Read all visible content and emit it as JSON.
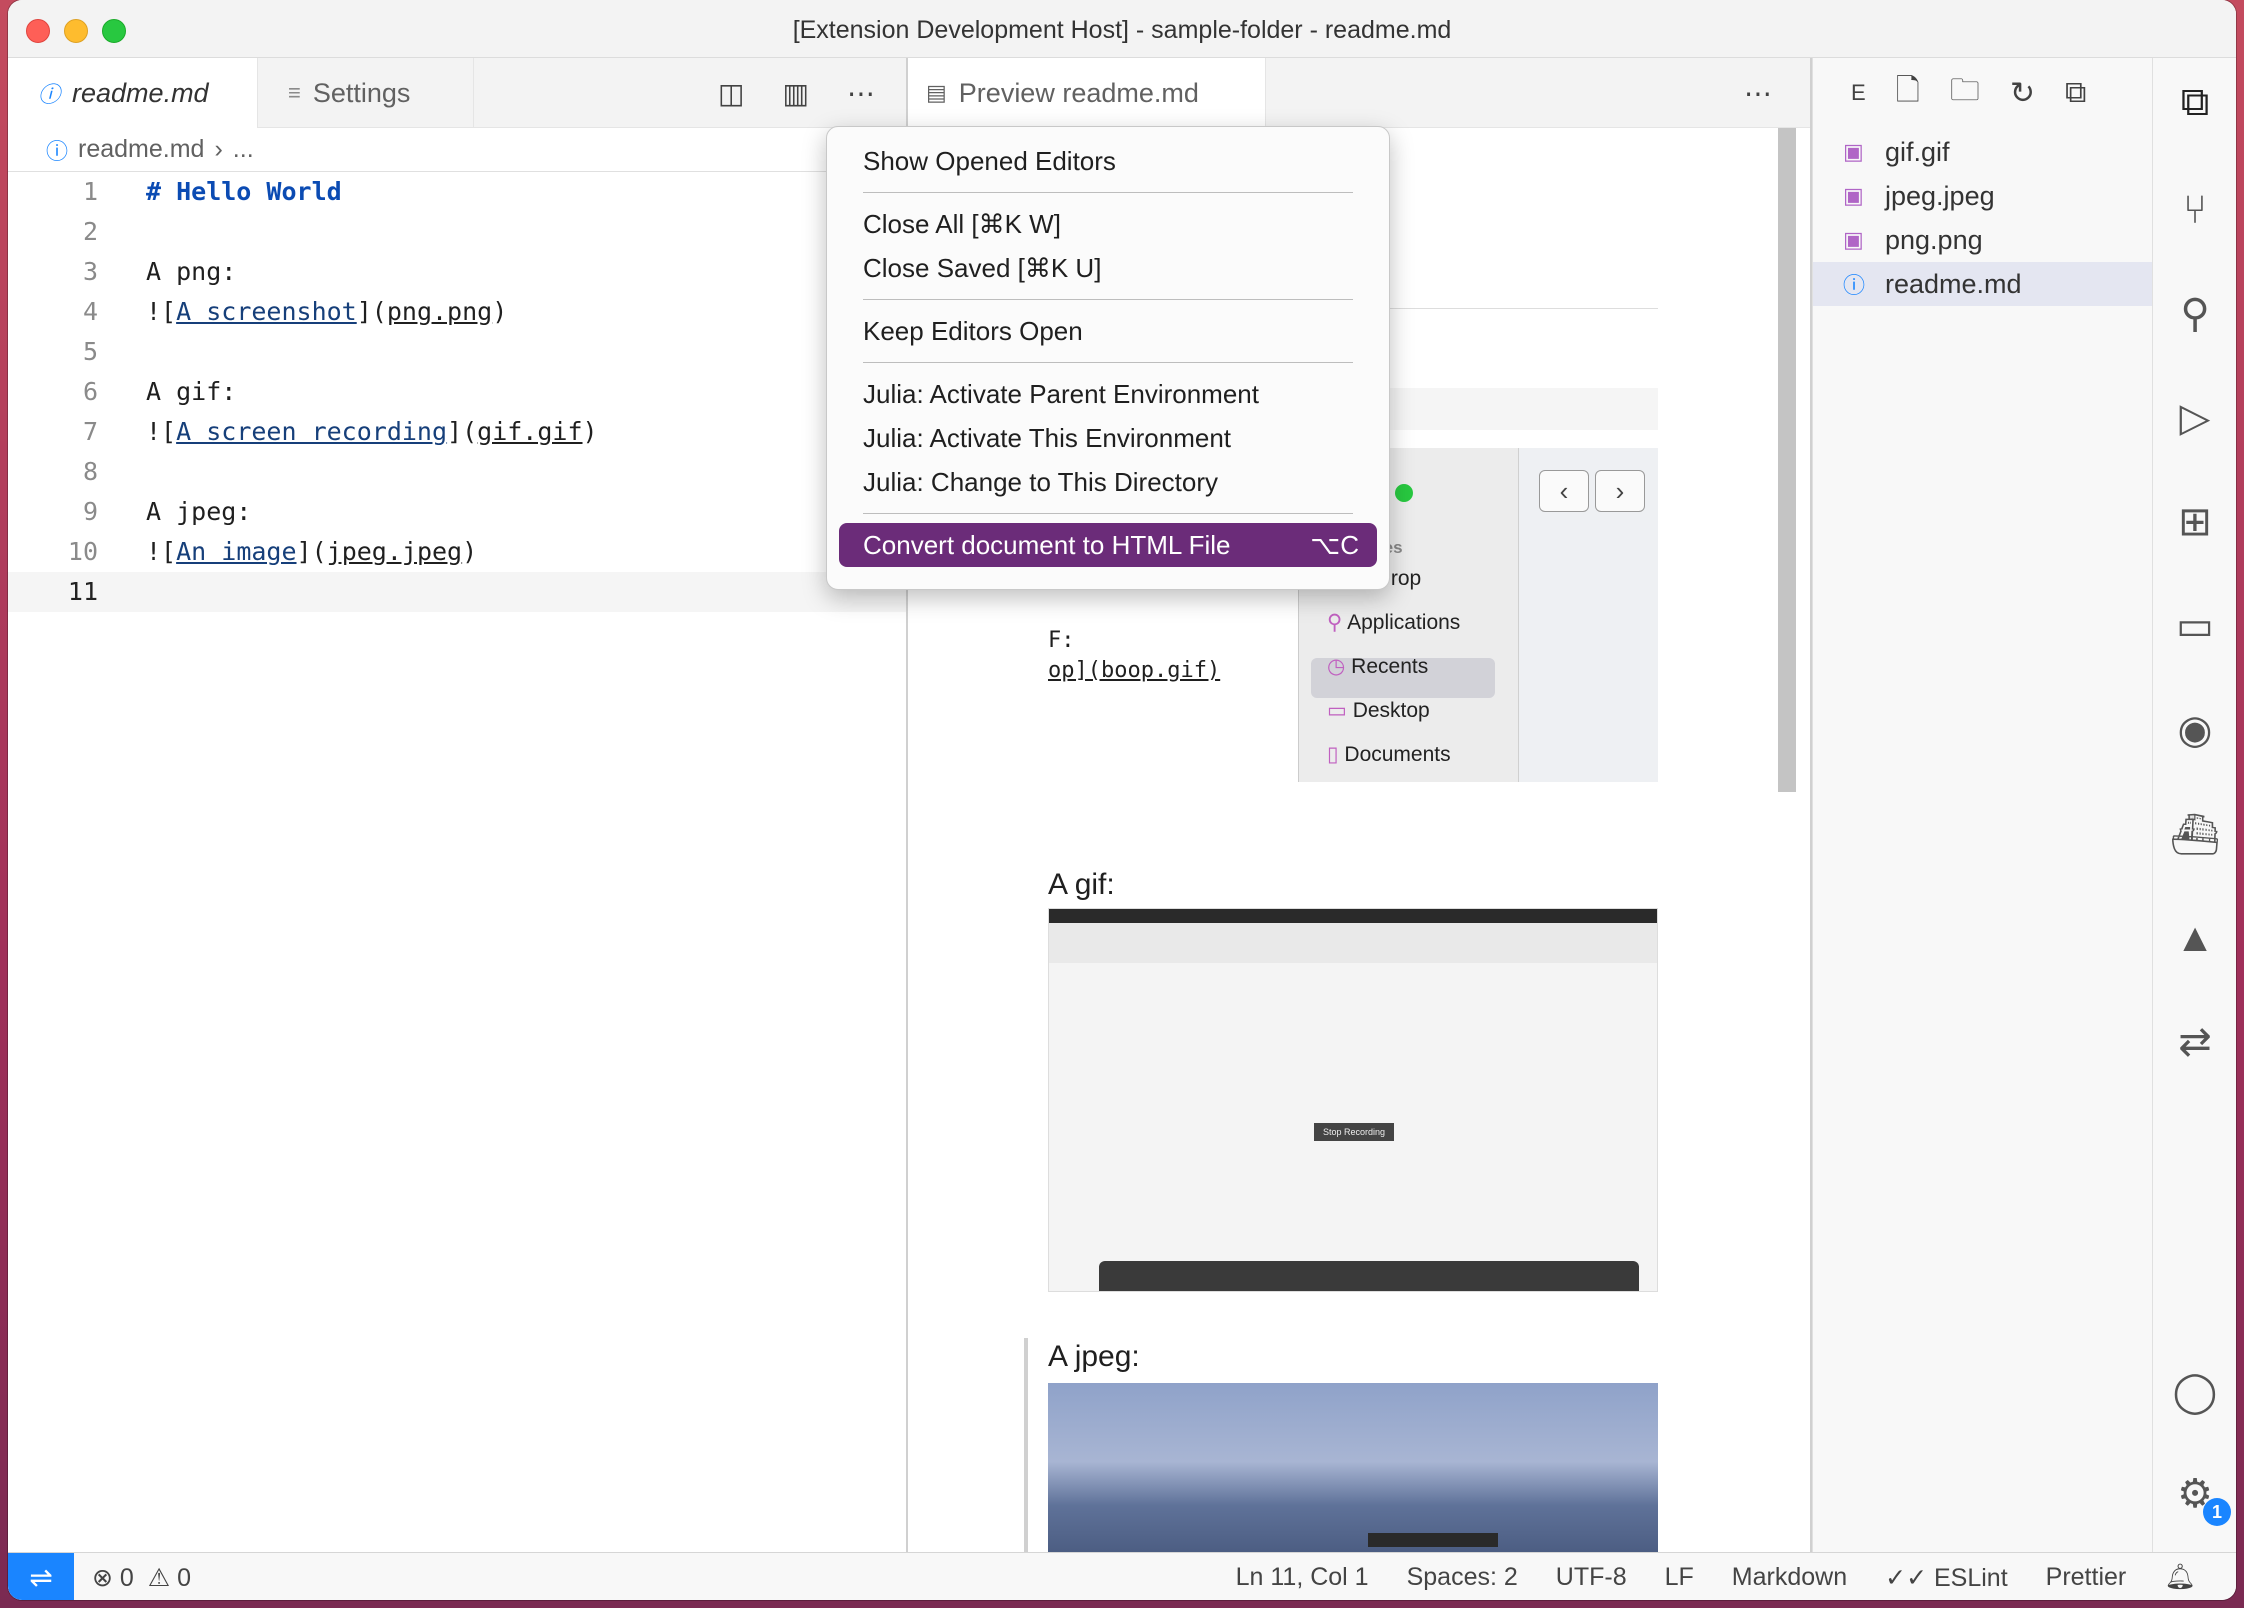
{
  "window": {
    "title": "[Extension Development Host] - sample-folder - readme.md"
  },
  "editor": {
    "tabs": [
      {
        "label": "readme.md",
        "active": true
      },
      {
        "label": "Settings",
        "active": false
      }
    ],
    "breadcrumb": {
      "file": "readme.md",
      "more": "..."
    },
    "lines": [
      {
        "num": "1",
        "text": "# Hello World"
      },
      {
        "num": "2",
        "text": ""
      },
      {
        "num": "3",
        "text": "A png:"
      },
      {
        "num": "4",
        "prefix": "![",
        "link": "A screenshot",
        "mid": "](",
        "target": "png.png",
        "suffix": ")"
      },
      {
        "num": "5",
        "text": ""
      },
      {
        "num": "6",
        "text": "A gif:"
      },
      {
        "num": "7",
        "prefix": "![",
        "link": "A screen recording",
        "mid": "](",
        "target": "gif.gif",
        "suffix": ")"
      },
      {
        "num": "8",
        "text": ""
      },
      {
        "num": "9",
        "text": "A jpeg:"
      },
      {
        "num": "10",
        "prefix": "![",
        "link": "An image",
        "mid": "](",
        "target": "jpeg.jpeg",
        "suffix": ")"
      },
      {
        "num": "11",
        "text": ""
      }
    ]
  },
  "preview": {
    "tab_label": "Preview readme.md",
    "fragment_code_1": "F:",
    "fragment_code_2": "op](boop.gif)",
    "gif_heading": "A gif:",
    "jpeg_heading": "A jpeg:",
    "finder": {
      "section": "Favorites",
      "items": [
        "AirDrop",
        "Applications",
        "Recents",
        "Desktop",
        "Documents"
      ],
      "selected": "Desktop"
    },
    "gif_button": "Stop Recording"
  },
  "explorer": {
    "toolbar_label": "E",
    "files": [
      {
        "name": "gif.gif",
        "type": "image"
      },
      {
        "name": "jpeg.jpeg",
        "type": "image"
      },
      {
        "name": "png.png",
        "type": "image"
      },
      {
        "name": "readme.md",
        "type": "markdown",
        "selected": true
      }
    ]
  },
  "context_menu": {
    "groups": [
      [
        {
          "label": "Show Opened Editors"
        }
      ],
      [
        {
          "label": "Close All [⌘K W]"
        },
        {
          "label": "Close Saved [⌘K U]"
        }
      ],
      [
        {
          "label": "Keep Editors Open"
        }
      ],
      [
        {
          "label": "Julia: Activate Parent Environment"
        },
        {
          "label": "Julia: Activate This Environment"
        },
        {
          "label": "Julia: Change to This Directory"
        }
      ],
      [
        {
          "label": "Convert document to HTML File",
          "shortcut": "⌥C",
          "highlighted": true
        }
      ]
    ]
  },
  "activity_bar": {
    "icons": [
      "explorer-icon",
      "source-control-icon",
      "search-icon",
      "run-debug-icon",
      "extensions-icon",
      "remote-explorer-icon",
      "github-icon",
      "docker-icon",
      "azure-icon",
      "live-share-icon",
      "account-icon",
      "settings-gear-icon"
    ],
    "settings_badge": "1"
  },
  "statusbar": {
    "errors": "0",
    "warnings": "0",
    "position": "Ln 11, Col 1",
    "spaces": "Spaces: 2",
    "encoding": "UTF-8",
    "eol": "LF",
    "language": "Markdown",
    "eslint": "ESLint",
    "prettier": "Prettier"
  },
  "colors": {
    "accent": "#1a85ff",
    "menu_highlight": "#6b2c79",
    "heading": "#0b4bb3"
  }
}
